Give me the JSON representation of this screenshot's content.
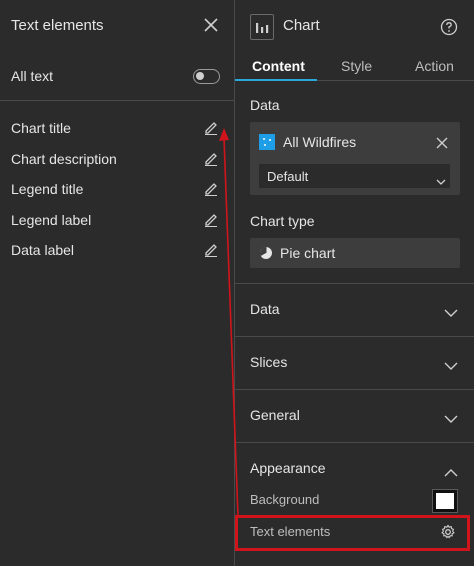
{
  "left_panel": {
    "title": "Text elements",
    "all_text_label": "All text",
    "elements": [
      {
        "label": "Chart title"
      },
      {
        "label": "Chart description"
      },
      {
        "label": "Legend title"
      },
      {
        "label": "Legend label"
      },
      {
        "label": "Data label"
      }
    ]
  },
  "right_panel": {
    "title": "Chart",
    "tabs": [
      {
        "label": "Content",
        "active": true
      },
      {
        "label": "Style",
        "active": false
      },
      {
        "label": "Action",
        "active": false
      }
    ],
    "data_section_label": "Data",
    "layer_name": "All Wildfires",
    "layer_view": "Default",
    "chart_type_label": "Chart type",
    "chart_type_value": "Pie chart",
    "accordions": [
      {
        "label": "Data",
        "expanded": false
      },
      {
        "label": "Slices",
        "expanded": false
      },
      {
        "label": "General",
        "expanded": false
      },
      {
        "label": "Appearance",
        "expanded": true
      }
    ],
    "appearance": {
      "background_label": "Background",
      "background_color": "#ffffff",
      "text_elements_label": "Text elements"
    }
  },
  "colors": {
    "accent": "#2ba8d8",
    "layer_icon": "#1d9ee6",
    "annotation": "#d0141b"
  }
}
